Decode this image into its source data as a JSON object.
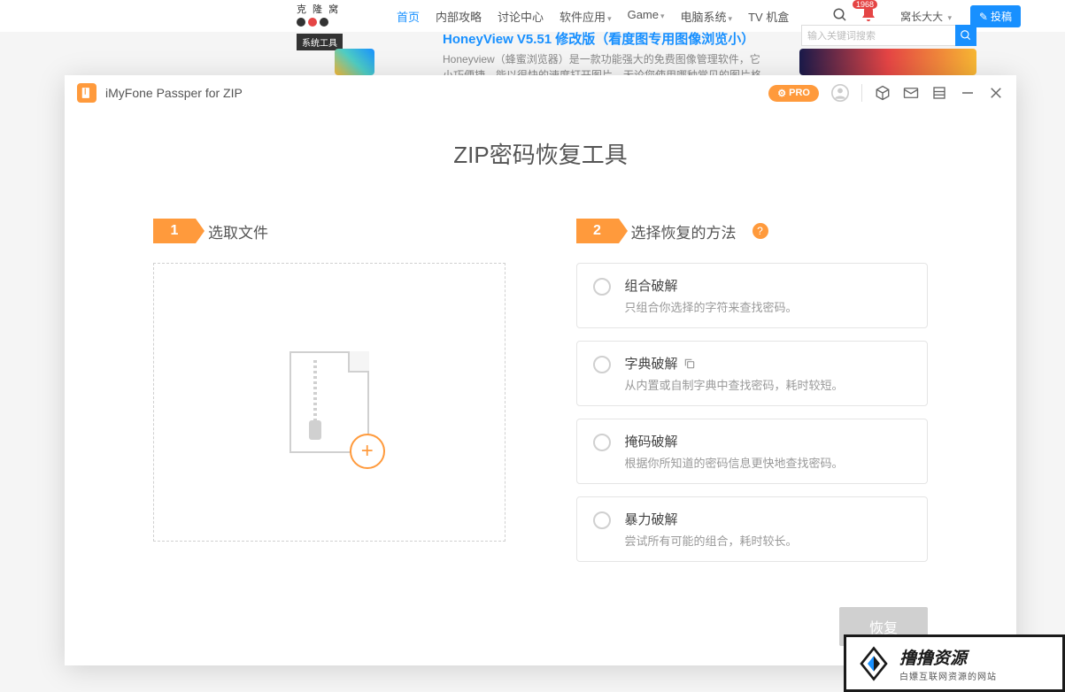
{
  "background": {
    "logo_text": "克 隆 窝",
    "nav": [
      "首页",
      "内部攻略",
      "讨论中心",
      "软件应用",
      "Game",
      "电脑系统",
      "TV 机盒"
    ],
    "nav_active_index": 0,
    "nav_dropdowns": [
      3,
      4,
      5
    ],
    "tag": "系统工具",
    "badge": "1968",
    "user": "窝长大大",
    "action_btn": "投稿",
    "article_title": "HoneyView V5.51 修改版（看度图专用图像浏览小）",
    "article_desc": "Honeyview（蜂蜜浏览器）是一款功能强大的免费图像管理软件，它小巧便捷，能以很快的速度打开图片。无论您使用哪种常见的图片格式，甚至是压缩包内的图片，Honeyview都能轻…",
    "search_placeholder": "输入关键词搜索"
  },
  "modal": {
    "app_title": "iMyFone Passper for ZIP",
    "pro_label": "PRO",
    "main_heading": "ZIP密码恢复工具",
    "step1": {
      "num": "1",
      "title": "选取文件"
    },
    "step2": {
      "num": "2",
      "title": "选择恢复的方法"
    },
    "options": [
      {
        "title": "组合破解",
        "desc": "只组合你选择的字符来查找密码。",
        "has_icon": false
      },
      {
        "title": "字典破解",
        "desc": "从内置或自制字典中查找密码，耗时较短。",
        "has_icon": true
      },
      {
        "title": "掩码破解",
        "desc": "根据你所知道的密码信息更快地查找密码。",
        "has_icon": false
      },
      {
        "title": "暴力破解",
        "desc": "尝试所有可能的组合，耗时较长。",
        "has_icon": false
      }
    ],
    "recover_btn": "恢复"
  },
  "watermark": {
    "main": "撸撸资源",
    "sub": "白嫖互联网资源的网站"
  }
}
